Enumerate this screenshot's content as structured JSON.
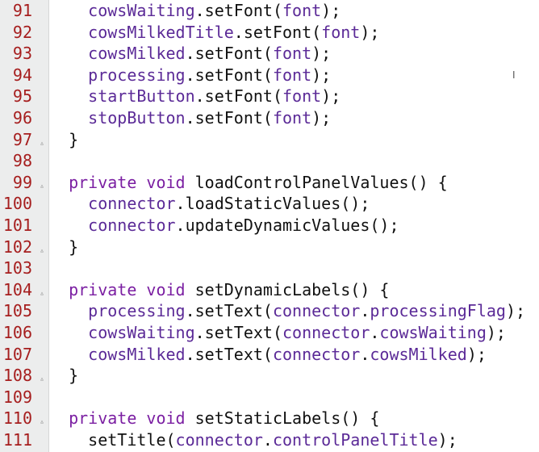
{
  "editor": {
    "lines": [
      {
        "num": "91",
        "fold": false,
        "indent": "    ",
        "tokens": [
          {
            "t": "cowsWaiting",
            "c": "ident"
          },
          {
            "t": ".setFont(",
            "c": "punc"
          },
          {
            "t": "font",
            "c": "ident"
          },
          {
            "t": ");",
            "c": "punc"
          }
        ]
      },
      {
        "num": "92",
        "fold": false,
        "indent": "    ",
        "tokens": [
          {
            "t": "cowsMilkedTitle",
            "c": "ident"
          },
          {
            "t": ".setFont(",
            "c": "punc"
          },
          {
            "t": "font",
            "c": "ident"
          },
          {
            "t": ");",
            "c": "punc"
          }
        ]
      },
      {
        "num": "93",
        "fold": false,
        "indent": "    ",
        "tokens": [
          {
            "t": "cowsMilked",
            "c": "ident"
          },
          {
            "t": ".setFont(",
            "c": "punc"
          },
          {
            "t": "font",
            "c": "ident"
          },
          {
            "t": ");",
            "c": "punc"
          }
        ]
      },
      {
        "num": "94",
        "fold": false,
        "indent": "    ",
        "tokens": [
          {
            "t": "processing",
            "c": "ident"
          },
          {
            "t": ".setFont(",
            "c": "punc"
          },
          {
            "t": "font",
            "c": "ident"
          },
          {
            "t": ");",
            "c": "punc"
          }
        ]
      },
      {
        "num": "95",
        "fold": false,
        "indent": "    ",
        "tokens": [
          {
            "t": "startButton",
            "c": "ident"
          },
          {
            "t": ".setFont(",
            "c": "punc"
          },
          {
            "t": "font",
            "c": "ident"
          },
          {
            "t": ");",
            "c": "punc"
          }
        ]
      },
      {
        "num": "96",
        "fold": false,
        "indent": "    ",
        "tokens": [
          {
            "t": "stopButton",
            "c": "ident"
          },
          {
            "t": ".setFont(",
            "c": "punc"
          },
          {
            "t": "font",
            "c": "ident"
          },
          {
            "t": ");",
            "c": "punc"
          }
        ]
      },
      {
        "num": "97",
        "fold": true,
        "indent": "  ",
        "tokens": [
          {
            "t": "}",
            "c": "punc"
          }
        ]
      },
      {
        "num": "98",
        "fold": false,
        "indent": "",
        "tokens": []
      },
      {
        "num": "99",
        "fold": true,
        "indent": "  ",
        "tokens": [
          {
            "t": "private void ",
            "c": "kw"
          },
          {
            "t": "loadControlPanelValues() {",
            "c": "punc"
          }
        ]
      },
      {
        "num": "100",
        "fold": false,
        "indent": "    ",
        "tokens": [
          {
            "t": "connector",
            "c": "ident"
          },
          {
            "t": ".loadStaticValues();",
            "c": "punc"
          }
        ]
      },
      {
        "num": "101",
        "fold": false,
        "indent": "    ",
        "tokens": [
          {
            "t": "connector",
            "c": "ident"
          },
          {
            "t": ".updateDynamicValues();",
            "c": "punc"
          }
        ]
      },
      {
        "num": "102",
        "fold": true,
        "indent": "  ",
        "tokens": [
          {
            "t": "}",
            "c": "punc"
          }
        ]
      },
      {
        "num": "103",
        "fold": false,
        "indent": "",
        "tokens": []
      },
      {
        "num": "104",
        "fold": true,
        "indent": "  ",
        "tokens": [
          {
            "t": "private void ",
            "c": "kw"
          },
          {
            "t": "setDynamicLabels() {",
            "c": "punc"
          }
        ]
      },
      {
        "num": "105",
        "fold": false,
        "indent": "    ",
        "tokens": [
          {
            "t": "processing",
            "c": "ident"
          },
          {
            "t": ".setText(",
            "c": "punc"
          },
          {
            "t": "connector",
            "c": "ident"
          },
          {
            "t": ".",
            "c": "punc"
          },
          {
            "t": "processingFlag",
            "c": "ident"
          },
          {
            "t": ");",
            "c": "punc"
          }
        ]
      },
      {
        "num": "106",
        "fold": false,
        "indent": "    ",
        "tokens": [
          {
            "t": "cowsWaiting",
            "c": "ident"
          },
          {
            "t": ".setText(",
            "c": "punc"
          },
          {
            "t": "connector",
            "c": "ident"
          },
          {
            "t": ".",
            "c": "punc"
          },
          {
            "t": "cowsWaiting",
            "c": "ident"
          },
          {
            "t": ");",
            "c": "punc"
          }
        ]
      },
      {
        "num": "107",
        "fold": false,
        "indent": "    ",
        "tokens": [
          {
            "t": "cowsMilked",
            "c": "ident"
          },
          {
            "t": ".setText(",
            "c": "punc"
          },
          {
            "t": "connector",
            "c": "ident"
          },
          {
            "t": ".",
            "c": "punc"
          },
          {
            "t": "cowsMilked",
            "c": "ident"
          },
          {
            "t": ");",
            "c": "punc"
          }
        ]
      },
      {
        "num": "108",
        "fold": true,
        "indent": "  ",
        "tokens": [
          {
            "t": "}",
            "c": "punc"
          }
        ]
      },
      {
        "num": "109",
        "fold": false,
        "indent": "",
        "tokens": []
      },
      {
        "num": "110",
        "fold": true,
        "indent": "  ",
        "tokens": [
          {
            "t": "private void ",
            "c": "kw"
          },
          {
            "t": "setStaticLabels() {",
            "c": "punc"
          }
        ]
      },
      {
        "num": "111",
        "fold": false,
        "indent": "    ",
        "tokens": [
          {
            "t": "setTitle(",
            "c": "punc"
          },
          {
            "t": "connector",
            "c": "ident"
          },
          {
            "t": ".",
            "c": "punc"
          },
          {
            "t": "controlPanelTitle",
            "c": "ident"
          },
          {
            "t": ");",
            "c": "punc"
          }
        ]
      }
    ]
  },
  "colors": {
    "keyword": "#7b1fa2",
    "identifier": "#5b2a97",
    "line_number": "#a61e1e",
    "gutter_bg": "#eceded"
  },
  "cursor_icon": "text-cursor-icon"
}
